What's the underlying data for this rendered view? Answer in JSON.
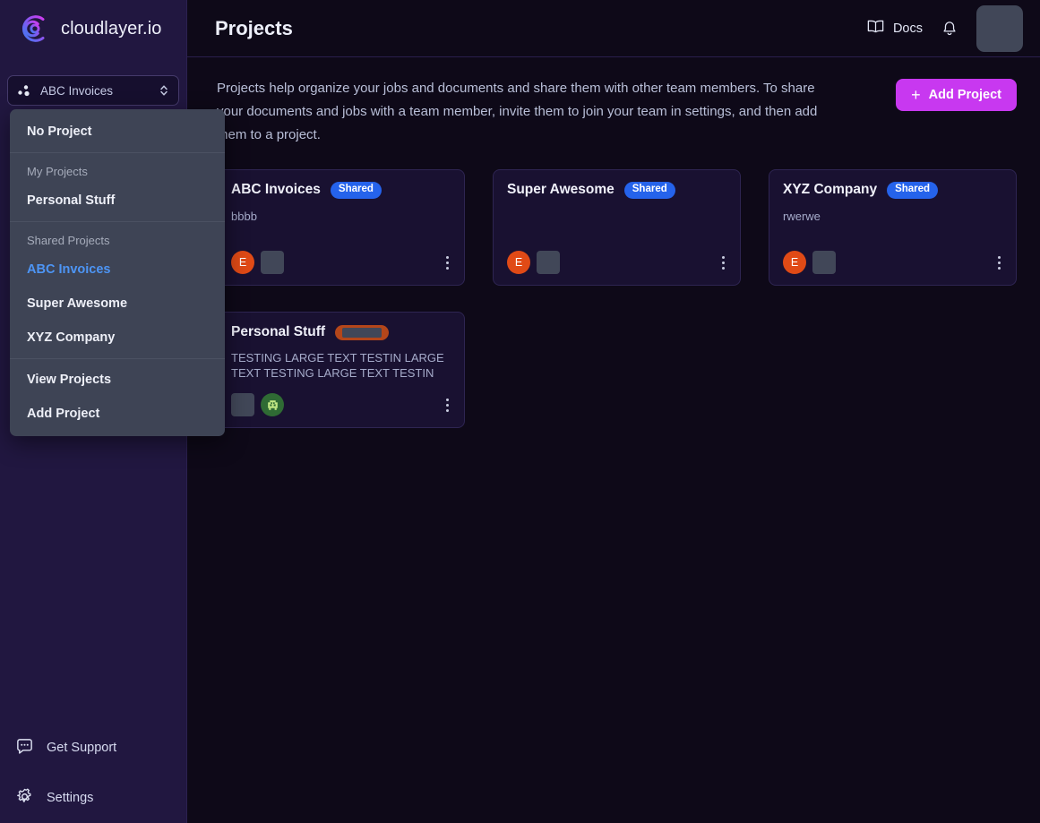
{
  "brand": {
    "name": "cloudlayer.io",
    "logo_icon": "cloudlayer-spiral-logo"
  },
  "sidebar": {
    "project_selector": {
      "value": "ABC Invoices",
      "left_icon": "three-dots-cluster-icon",
      "right_icon": "chevron-up-down-icon"
    },
    "bottom_items": [
      {
        "label": "Get Support",
        "icon": "chat-bubble-icon"
      },
      {
        "label": "Settings",
        "icon": "gear-icon"
      }
    ]
  },
  "header": {
    "title": "Projects",
    "docs_label": "Docs",
    "docs_icon": "book-icon",
    "bell_icon": "bell-icon",
    "avatar": "user-avatar-placeholder"
  },
  "main": {
    "intro": "Projects help organize your jobs and documents and share them with other team members. To share your documents and jobs with a team member, invite them to join your team in settings, and then add them to a project.",
    "add_project_label": "Add Project",
    "add_project_icon": "plus-icon",
    "accent_color": "#c838f0"
  },
  "dropdown": {
    "no_project_label": "No Project",
    "my_projects_label": "My Projects",
    "my_projects": [
      "Personal Stuff"
    ],
    "shared_projects_label": "Shared Projects",
    "shared_projects": [
      "ABC Invoices",
      "Super Awesome",
      "XYZ Company"
    ],
    "selected": "ABC Invoices",
    "view_projects_label": "View Projects",
    "add_project_label": "Add Project"
  },
  "cards": [
    {
      "title": "ABC Invoices",
      "badge": "Shared",
      "badge_type": "shared",
      "description": "bbbb",
      "avatars": [
        "initial-e",
        "placeholder-box"
      ],
      "menu_icon": "kebab-menu-icon"
    },
    {
      "title": "Super Awesome",
      "badge": "Shared",
      "badge_type": "shared",
      "description": "",
      "avatars": [
        "initial-e",
        "placeholder-box"
      ],
      "menu_icon": "kebab-menu-icon"
    },
    {
      "title": "XYZ Company",
      "badge": "Shared",
      "badge_type": "shared",
      "description": "rwerwe",
      "avatars": [
        "initial-e",
        "placeholder-box"
      ],
      "menu_icon": "kebab-menu-icon"
    },
    {
      "title": "Personal Stuff",
      "badge": "",
      "badge_type": "loading",
      "description": "TESTING LARGE TEXT TESTIN LARGE TEXT TESTING LARGE TEXT TESTIN LARGE TEX…",
      "avatars": [
        "placeholder-box",
        "alien"
      ],
      "menu_icon": "kebab-menu-icon"
    }
  ],
  "avatar_initial": "E"
}
